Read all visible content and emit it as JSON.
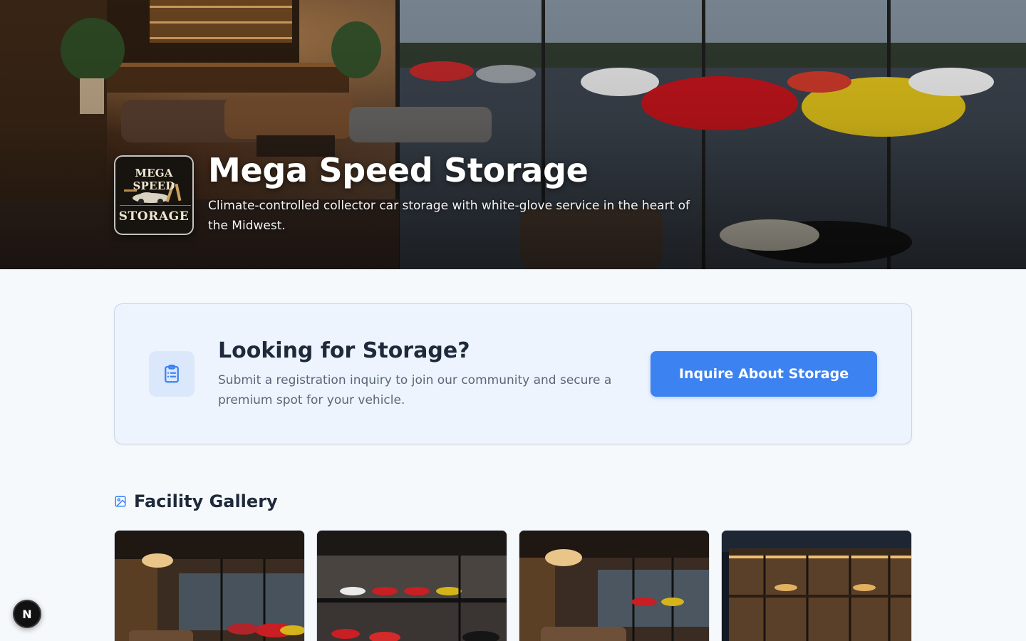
{
  "hero": {
    "title": "Mega Speed Storage",
    "subtitle": "Climate-controlled collector car storage with white-glove service in the heart of the Midwest.",
    "logo": {
      "top_text": "MEGA SPEED",
      "bottom_text": "STORAGE"
    }
  },
  "inquiry": {
    "icon": "clipboard-list-icon",
    "title": "Looking for Storage?",
    "description": "Submit a registration inquiry to join our community and secure a premium spot for your vehicle.",
    "button_label": "Inquire About Storage"
  },
  "gallery": {
    "icon": "image-icon",
    "title": "Facility Gallery",
    "images": [
      {
        "name": "gallery-image-1"
      },
      {
        "name": "gallery-image-2"
      },
      {
        "name": "gallery-image-3"
      },
      {
        "name": "gallery-image-4"
      }
    ]
  },
  "badge": {
    "label": "N"
  },
  "colors": {
    "page_background": "#f6f9fc",
    "card_background": "#eef4fd",
    "card_border": "#c9d6e8",
    "accent_button": "#3c82f0",
    "heading_text": "#1e293b",
    "body_text": "#5b6678",
    "icon_blue": "#3b82f6"
  }
}
